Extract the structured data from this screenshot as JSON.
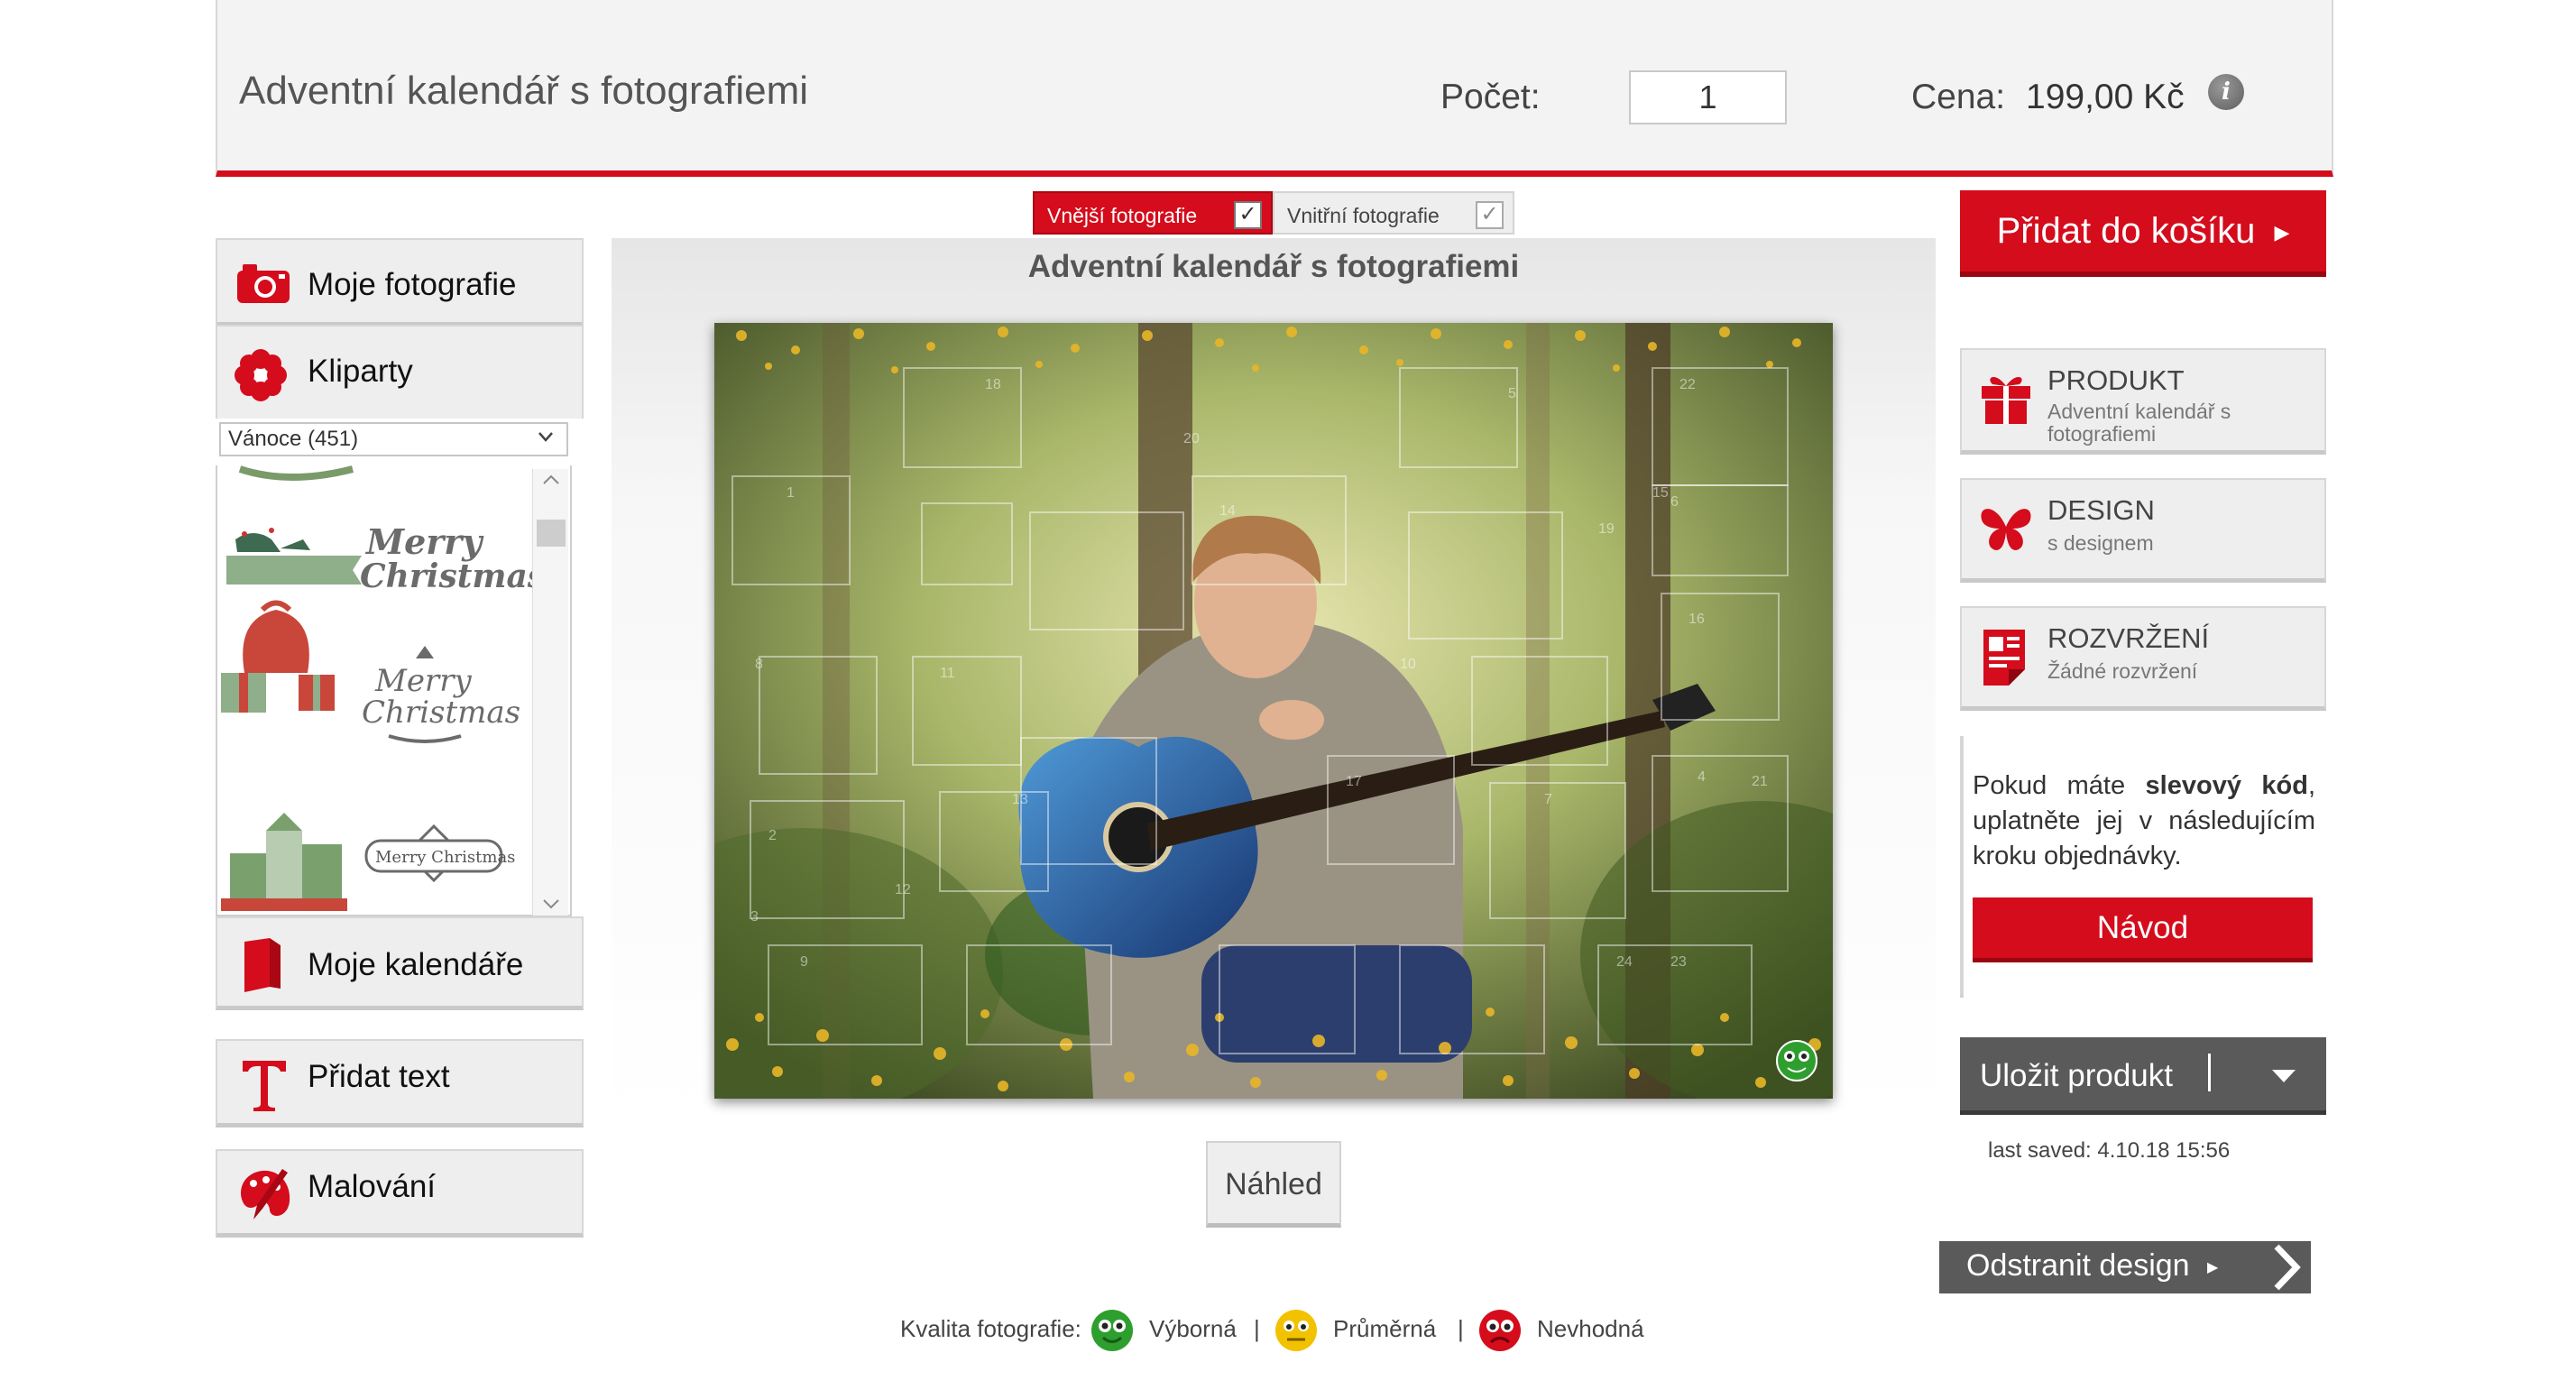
{
  "header": {
    "title": "Adventní kalendář s fotografiemi",
    "quantity_label": "Počet:",
    "quantity_value": "1",
    "price_label": "Cena:",
    "price_value": "199,00 Kč",
    "info_icon": "i"
  },
  "tabs": [
    {
      "label": "Vnější fotografie",
      "checked": true,
      "active": true
    },
    {
      "label": "Vnitřní fotografie",
      "checked": true,
      "active": false
    }
  ],
  "left_panel": {
    "my_photos": "Moje fotografie",
    "cliparts": "Kliparty",
    "category_select": "Vánoce (451)",
    "clipart_texts": [
      "Merry Christmas",
      "Merry Christmas",
      "Merry Christmas"
    ],
    "my_calendars": "Moje kalendáře",
    "add_text": "Přidat text",
    "painting": "Malování"
  },
  "canvas": {
    "title": "Adventní kalendář s fotografiemi",
    "door_numbers": [
      "22",
      "16",
      "10",
      "5",
      "4",
      "2",
      "18",
      "11",
      "14",
      "24",
      "6",
      "8",
      "13",
      "1",
      "7",
      "3",
      "9",
      "20",
      "15",
      "19",
      "21",
      "12",
      "23",
      "17"
    ],
    "preview_button": "Náhled"
  },
  "quality": {
    "label": "Kvalita fotografie:",
    "levels": [
      {
        "name": "Výborná",
        "color": "#2e9e2e"
      },
      {
        "name": "Průměrná",
        "color": "#f2c200"
      },
      {
        "name": "Nevhodná",
        "color": "#d40c1c"
      }
    ],
    "separator": "|"
  },
  "right_panel": {
    "add_to_cart": "Přidat do košíku",
    "product_title": "PRODUKT",
    "product_sub": "Adventní kalendář s fotografiemi",
    "design_title": "DESIGN",
    "design_sub": "s designem",
    "layout_title": "ROZVRŽENÍ",
    "layout_sub": "Žádné rozvržení",
    "coupon_text_1": "Pokud máte ",
    "coupon_bold": "slevový kód",
    "coupon_text_2": ", uplatněte jej v následujícím kroku objednávky.",
    "guide_button": "Návod",
    "save_button": "Uložit produkt",
    "last_saved": "last saved: 4.10.18 15:56",
    "remove_design": "Odstranit design"
  },
  "colors": {
    "brand_red": "#d40c1c",
    "dark_button": "#5a5a5a",
    "panel_bg": "#eeeeee"
  }
}
